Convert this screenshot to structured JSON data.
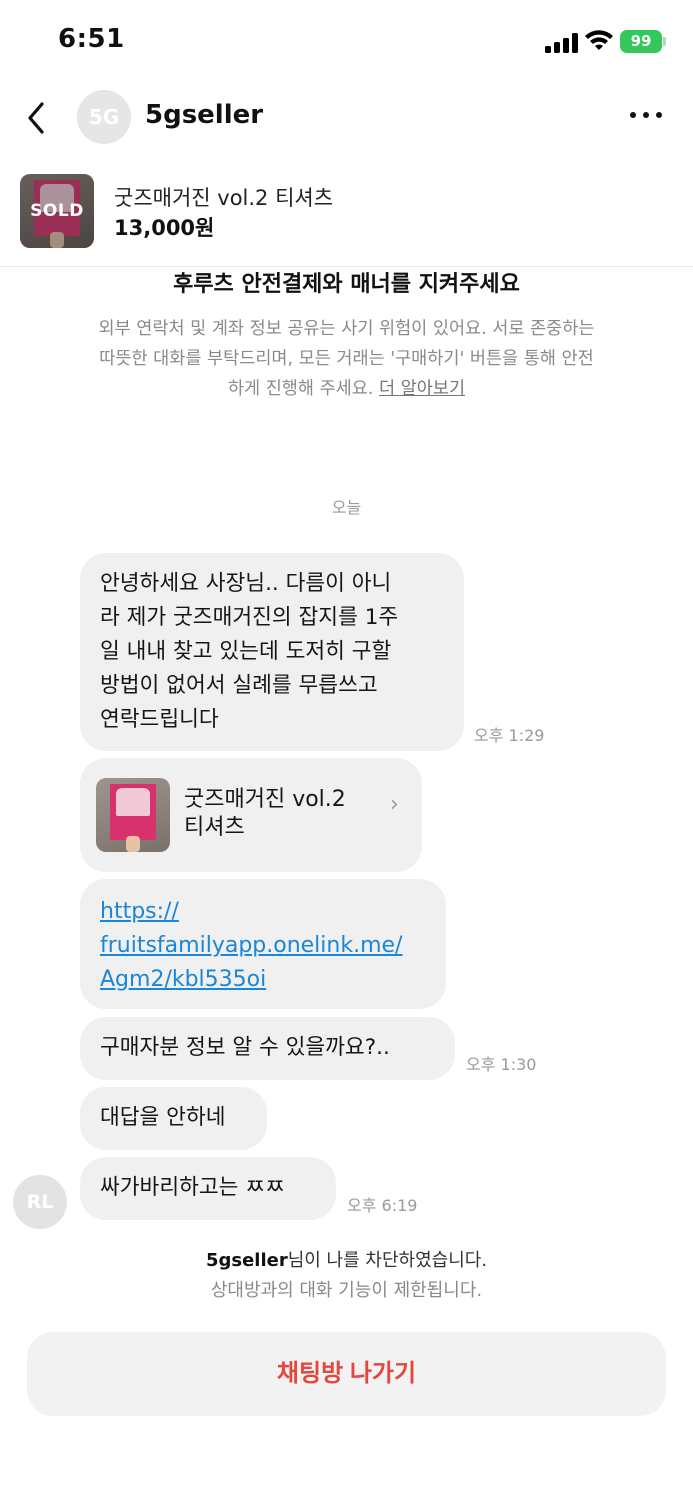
{
  "status_bar": {
    "time": "6:51",
    "battery": "99"
  },
  "header": {
    "avatar_text": "5G",
    "title": "5gseller"
  },
  "product": {
    "sold_badge": "SOLD",
    "name": "굿즈매거진 vol.2 티셔츠",
    "price": "13,000원"
  },
  "notice": {
    "title": "후루츠 안전결제와 매너를 지켜주세요",
    "line1": "외부 연락처 및 계좌 정보 공유는 사기 위험이 있어요. 서로 존중하는",
    "line2": "따뜻한 대화를 부탁드리며, 모든 거래는 '구매하기' 버튼을 통해 안전",
    "line3": "하게 진행해 주세요. ",
    "link": "더 알아보기"
  },
  "date_divider": "오늘",
  "messages": {
    "m1": {
      "lines": [
        "안녕하세요 사장님.. 다름이 아니",
        "라 제가 굿즈매거진의 잡지를 1주",
        "일 내내 찾고 있는데 도저히 구할",
        "방법이 없어서 실례를 무릅쓰고",
        "연락드립니다"
      ],
      "time": "오후 1:29"
    },
    "m2": {
      "card_line1": "굿즈매거진 vol.2",
      "card_line2": "티셔츠"
    },
    "m3": {
      "link_lines": [
        "https://",
        "fruitsfamilyapp.onelink.me/",
        "Agm2/kbl535oi"
      ]
    },
    "m4": {
      "text": "구매자분 정보 알 수 있을까요?..",
      "time": "오후 1:30"
    },
    "m5": {
      "text": "대답을 안하네"
    },
    "m6": {
      "text": "싸가바리하고는 ㅉㅉ",
      "time": "오후 6:19"
    },
    "sender_avatar": "RL"
  },
  "block_notice": {
    "name": "5gseller",
    "line1_suffix": "님이 나를 차단하였습니다.",
    "line2": "상대방과의 대화 기능이 제한됩니다."
  },
  "leave_button": "채팅방 나가기",
  "colors": {
    "accent_red": "#e2483d",
    "link_blue": "#1a86d9",
    "battery_green": "#34c759"
  }
}
